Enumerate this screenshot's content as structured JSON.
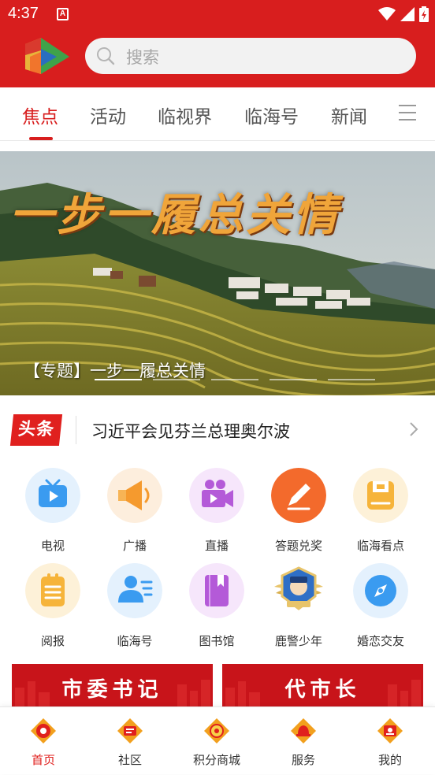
{
  "status_bar": {
    "time": "4:37",
    "notif_letter": "A"
  },
  "search": {
    "placeholder": "搜索"
  },
  "tabs": [
    {
      "label": "焦点",
      "active": true
    },
    {
      "label": "活动"
    },
    {
      "label": "临视界"
    },
    {
      "label": "临海号"
    },
    {
      "label": "新闻"
    }
  ],
  "banner": {
    "title_art": "一步一履总关情",
    "caption": "【专题】一步一履总关情"
  },
  "headline": {
    "badge": "头条",
    "text": "习近平会见芬兰总理奥尔波"
  },
  "services": [
    {
      "label": "电视",
      "icon": "tv-icon"
    },
    {
      "label": "广播",
      "icon": "megaphone-icon"
    },
    {
      "label": "直播",
      "icon": "video-camera-icon"
    },
    {
      "label": "答题兑奖",
      "icon": "pencil-icon"
    },
    {
      "label": "临海看点",
      "icon": "bookmark-box-icon"
    },
    {
      "label": "阅报",
      "icon": "clipboard-icon"
    },
    {
      "label": "临海号",
      "icon": "user-list-icon"
    },
    {
      "label": "图书馆",
      "icon": "book-icon"
    },
    {
      "label": "鹿警少年",
      "icon": "police-badge-icon"
    },
    {
      "label": "婚恋交友",
      "icon": "compass-icon"
    }
  ],
  "promos": [
    {
      "label": "市委书记"
    },
    {
      "label": "代市长"
    }
  ],
  "bottom_nav": [
    {
      "label": "首页",
      "active": true
    },
    {
      "label": "社区"
    },
    {
      "label": "积分商城"
    },
    {
      "label": "服务"
    },
    {
      "label": "我的"
    }
  ],
  "colors": {
    "brand_red": "#d81e1e",
    "tab_active": "#d81e1e",
    "nav_active": "#e0201e"
  }
}
